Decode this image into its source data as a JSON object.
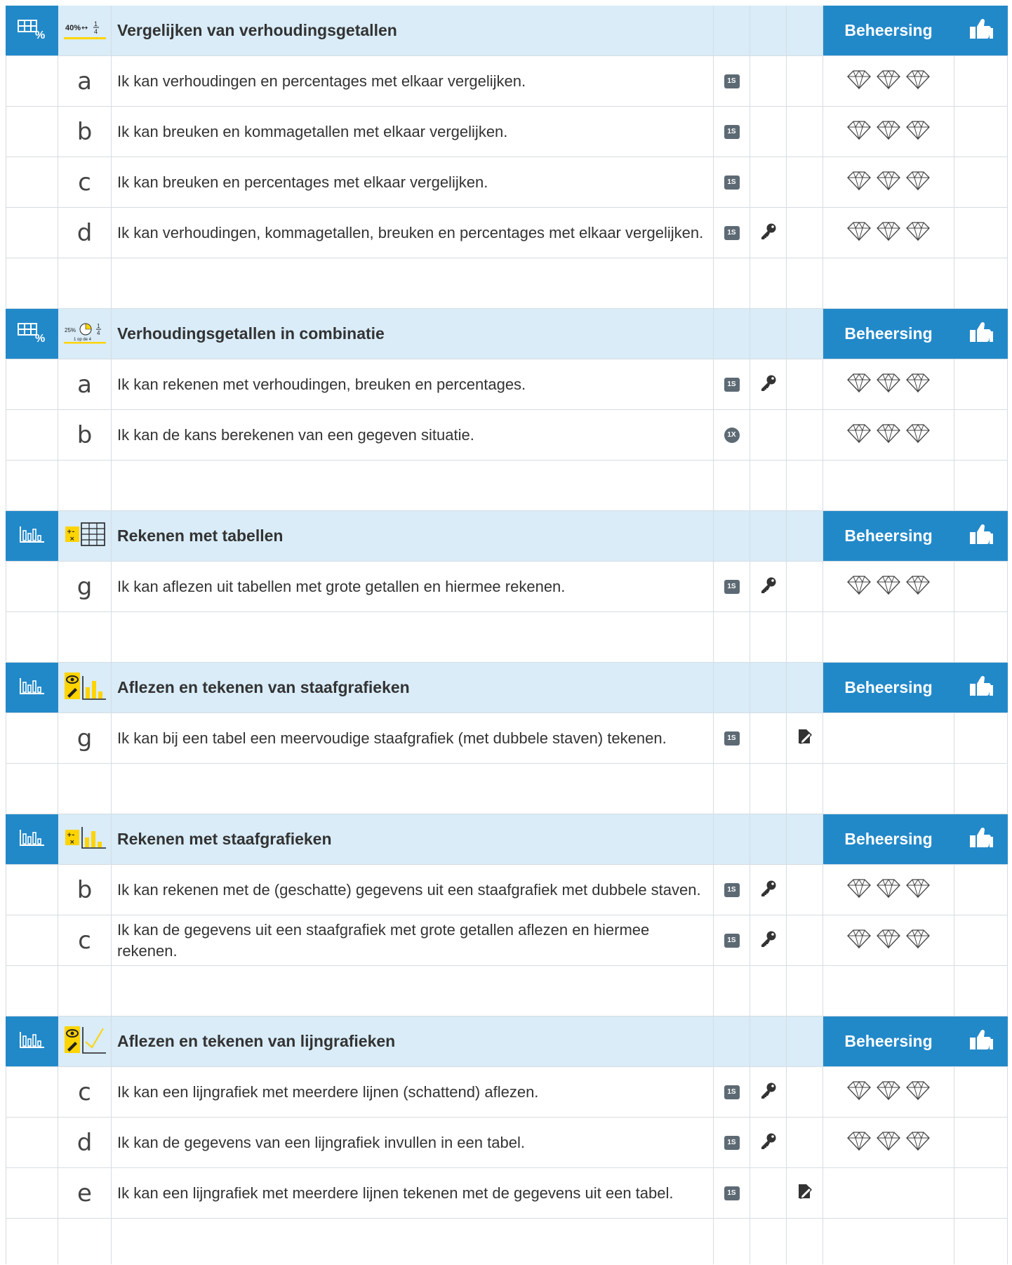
{
  "mastery_label": "Beheersing",
  "sections": [
    {
      "category_icon": "table-percent-icon",
      "topic_icon": "ratio-compare-icon",
      "topic_icon_text": "40% ↔ 1/4",
      "title": "Vergelijken van verhoudingsgetallen",
      "goals": [
        {
          "letter": "a",
          "text": "Ik kan verhoudingen en percentages met elkaar vergelijken.",
          "badge": "1S",
          "key": false,
          "draw": false,
          "gems": true
        },
        {
          "letter": "b",
          "text": "Ik kan breuken en kommagetallen met elkaar vergelijken.",
          "badge": "1S",
          "key": false,
          "draw": false,
          "gems": true
        },
        {
          "letter": "c",
          "text": "Ik kan breuken en percentages met elkaar vergelijken.",
          "badge": "1S",
          "key": false,
          "draw": false,
          "gems": true
        },
        {
          "letter": "d",
          "text": "Ik kan verhoudingen, kommagetallen, breuken en percentages met elkaar vergelijken.",
          "badge": "1S",
          "key": true,
          "draw": false,
          "gems": true
        }
      ]
    },
    {
      "category_icon": "table-percent-icon",
      "topic_icon": "ratio-combination-icon",
      "topic_icon_text": "25%  1/4",
      "topic_icon_subtext": "1 op de 4",
      "title": "Verhoudingsgetallen in combinatie",
      "goals": [
        {
          "letter": "a",
          "text": "Ik kan rekenen met verhoudingen, breuken en percentages.",
          "badge": "1S",
          "key": true,
          "draw": false,
          "gems": true
        },
        {
          "letter": "b",
          "text": "Ik kan de kans berekenen van een gegeven situatie.",
          "badge": "1X",
          "key": false,
          "draw": false,
          "gems": true
        }
      ]
    },
    {
      "category_icon": "bar-chart-icon",
      "topic_icon": "calc-table-icon",
      "title": "Rekenen met tabellen",
      "goals": [
        {
          "letter": "g",
          "text": "Ik kan aflezen uit tabellen met grote getallen en hiermee rekenen.",
          "badge": "1S",
          "key": true,
          "draw": false,
          "gems": true
        }
      ]
    },
    {
      "category_icon": "bar-chart-icon",
      "topic_icon": "read-draw-bar-chart-icon",
      "title": "Aflezen en tekenen van staafgrafieken",
      "goals": [
        {
          "letter": "g",
          "text": "Ik kan bij een tabel een meervoudige staafgrafiek (met dubbele staven) tekenen.",
          "badge": "1S",
          "key": false,
          "draw": true,
          "gems": false
        }
      ]
    },
    {
      "category_icon": "bar-chart-icon",
      "topic_icon": "calc-bar-chart-icon",
      "title": "Rekenen met staafgrafieken",
      "goals": [
        {
          "letter": "b",
          "text": "Ik kan rekenen met de (geschatte) gegevens uit een staafgrafiek met dubbele staven.",
          "badge": "1S",
          "key": true,
          "draw": false,
          "gems": true
        },
        {
          "letter": "c",
          "text": "Ik kan de gegevens uit een staafgrafiek met grote getallen aflezen en hiermee rekenen.",
          "badge": "1S",
          "key": true,
          "draw": false,
          "gems": true
        }
      ]
    },
    {
      "category_icon": "bar-chart-icon",
      "topic_icon": "read-draw-line-chart-icon",
      "title": "Aflezen en tekenen van lijngrafieken",
      "goals": [
        {
          "letter": "c",
          "text": "Ik kan een lijngrafiek met meerdere lijnen (schattend) aflezen.",
          "badge": "1S",
          "key": true,
          "draw": false,
          "gems": true
        },
        {
          "letter": "d",
          "text": "Ik kan de gegevens van een lijngrafiek invullen in een tabel.",
          "badge": "1S",
          "key": true,
          "draw": false,
          "gems": true
        },
        {
          "letter": "e",
          "text": "Ik kan een lijngrafiek met meerdere lijnen tekenen met de gegevens uit een tabel.",
          "badge": "1S",
          "key": false,
          "draw": true,
          "gems": false
        }
      ]
    }
  ],
  "colors": {
    "header_blue": "#2289c9",
    "header_light": "#d9ecf8",
    "badge_grey": "#5d6a74",
    "icon_yellow": "#ffd400"
  }
}
